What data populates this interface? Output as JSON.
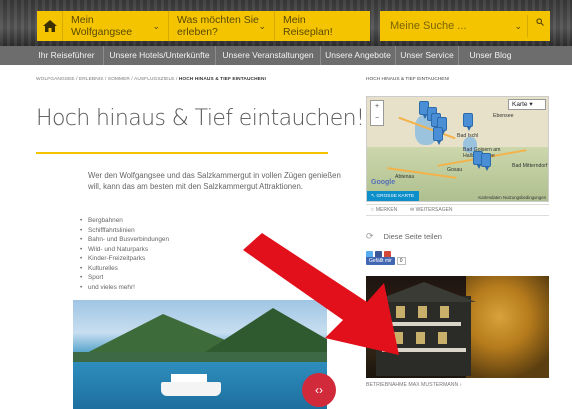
{
  "header": {
    "nav": [
      {
        "label_line1": "Mein",
        "label_line2": "Wolfgangsee"
      },
      {
        "label_line1": "Was möchten Sie",
        "label_line2": "erleben?"
      },
      {
        "label_line1": "Mein",
        "label_line2": "Reiseplan!"
      }
    ],
    "search_placeholder": "Meine Suche ...",
    "menu": [
      "Ihr Reiseführer",
      "Unsere Hotels/Unterkünfte",
      "Unsere Veranstaltungen",
      "Unsere Angebote",
      "Unser Service",
      "Unser Blog"
    ]
  },
  "main": {
    "breadcrumb": "WOLFGANGSEE / ERLEBNIS / SOMMER / AUSFLUGSZIELE / ",
    "breadcrumb_current": "HOCH HINAUS & TIEF EINTAUCHEN!",
    "title": "Hoch hinaus & Tief eintauchen!",
    "intro": "Wer den Wolfgangsee und das Salzkammergut in vollen Zügen genießen will, kann das am besten mit den Salzkammergut Attraktionen.",
    "bullets": [
      "Bergbahnen",
      "Schifffahrtslinien",
      "Bahn- und Busverbindungen",
      "Wild- und Naturparks",
      "Kinder-Freizeitparks",
      "Kulturelles",
      "Sport",
      "und vieles mehr!"
    ]
  },
  "sidebar": {
    "breadcrumb": "HOCH HINAUS & TIEF EINTAUCHEN!",
    "map": {
      "type_select": "Karte",
      "large_map_button": "GROSSE KARTE",
      "google": "Google",
      "terms": "Kartendaten  Nutzungsbedingungen",
      "towns": [
        "Bad Ischl",
        "Bad Goisern am Hallstättersee",
        "Gosau",
        "Abtenau",
        "Bad Mitterndorf",
        "Ebensee"
      ]
    },
    "remember": "MERKEN",
    "forward": "WEITERSAGEN",
    "share": "Diese Seite teilen",
    "like_label": "Gefällt mir",
    "like_count": "0",
    "photo_caption": "BETRIEBNAHME MAX MUSTERMANN"
  },
  "colors": {
    "accent": "#f5c400",
    "menu": "#6d6d6d",
    "arrow": "#e2101a",
    "map_button": "#0c8fca"
  }
}
